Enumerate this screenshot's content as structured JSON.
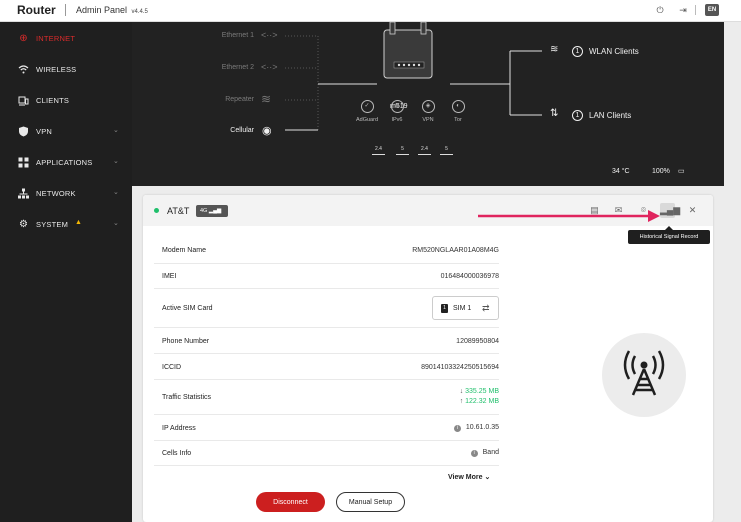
{
  "header": {
    "brand": "Router",
    "panel_name": "Admin Panel",
    "version": "v4.4.5",
    "language": "EN",
    "icons": [
      "power-icon",
      "logout-icon",
      "separator"
    ]
  },
  "sidebar": {
    "items": [
      {
        "label": "INTERNET",
        "icon": "globe-icon",
        "active": true,
        "has_chevron": false
      },
      {
        "label": "WIRELESS",
        "icon": "wifi-icon",
        "active": false,
        "has_chevron": false
      },
      {
        "label": "CLIENTS",
        "icon": "clients-icon",
        "active": false,
        "has_chevron": false
      },
      {
        "label": "VPN",
        "icon": "shield-icon",
        "active": false,
        "has_chevron": true
      },
      {
        "label": "APPLICATIONS",
        "icon": "apps-grid-icon",
        "active": false,
        "has_chevron": true
      },
      {
        "label": "NETWORK",
        "icon": "network-icon",
        "active": false,
        "has_chevron": true
      },
      {
        "label": "SYSTEM",
        "icon": "gear-icon",
        "active": false,
        "has_chevron": true,
        "warning": true
      }
    ],
    "accent_color": "#d92b2b"
  },
  "topology": {
    "connections": [
      {
        "label": "Ethernet 1",
        "icon": "ethernet-icon",
        "active": false
      },
      {
        "label": "Ethernet 2",
        "icon": "ethernet-icon",
        "active": false
      },
      {
        "label": "Repeater",
        "icon": "wifi-icon",
        "active": false
      },
      {
        "label": "Cellular",
        "icon": "cellular-icon",
        "active": true
      }
    ],
    "device_name": "m519",
    "features": [
      {
        "label": "AdGuard",
        "icon": "adguard-icon"
      },
      {
        "label": "IPv6",
        "icon": "ipv6-icon"
      },
      {
        "label": "VPN",
        "icon": "vpn-icon"
      },
      {
        "label": "Tor",
        "icon": "tor-icon"
      }
    ],
    "bands": [
      "2.4",
      "5",
      "2.4",
      "5"
    ],
    "wlan": {
      "count": "1",
      "label": "WLAN Clients"
    },
    "lan": {
      "count": "1",
      "label": "LAN Clients"
    },
    "temperature": "34 °C",
    "battery": "100%"
  },
  "card": {
    "carrier": "AT&T",
    "network_type": "4G",
    "status_color": "#1fbf6b",
    "tooltip": "Historical Signal Record",
    "rows": {
      "modem_name": {
        "label": "Modem Name",
        "value": "RM520NGLAAR01A08M4G"
      },
      "imei": {
        "label": "IMEI",
        "value": "016484000036978"
      },
      "active_sim": {
        "label": "Active SIM Card",
        "chip": "1",
        "value": "SIM 1"
      },
      "phone": {
        "label": "Phone Number",
        "value": "12089950804"
      },
      "iccid": {
        "label": "ICCID",
        "value": "89014103324250515694"
      },
      "traffic": {
        "label": "Traffic Statistics",
        "down": "335.25 MB",
        "up": "122.32 MB"
      },
      "ip": {
        "label": "IP Address",
        "value": "10.61.0.35"
      },
      "cells": {
        "label": "Cells Info",
        "value": "Band"
      }
    },
    "view_more": "View More",
    "disconnect": "Disconnect",
    "manual_setup": "Manual Setup"
  }
}
